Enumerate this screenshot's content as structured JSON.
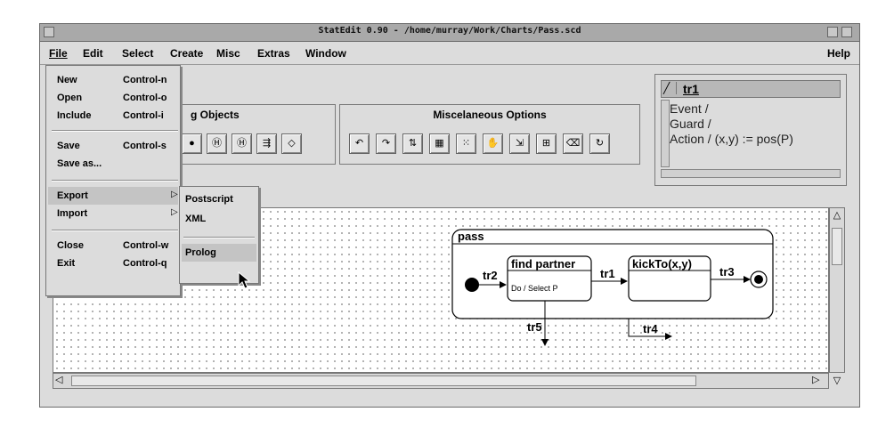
{
  "window": {
    "title": "StatEdit 0.90 - /home/murray/Work/Charts/Pass.scd"
  },
  "menubar": {
    "items": [
      "File",
      "Edit",
      "Select",
      "Create",
      "Misc",
      "Extras",
      "Window"
    ],
    "help": "Help"
  },
  "file_menu": {
    "items": [
      {
        "label": "New",
        "shortcut": "Control-n"
      },
      {
        "label": "Open",
        "shortcut": "Control-o"
      },
      {
        "label": "Include",
        "shortcut": "Control-i"
      },
      {
        "label": "Save",
        "shortcut": "Control-s"
      },
      {
        "label": "Save as...",
        "shortcut": ""
      },
      {
        "label": "Export",
        "shortcut": ""
      },
      {
        "label": "Import",
        "shortcut": ""
      },
      {
        "label": "Close",
        "shortcut": "Control-w"
      },
      {
        "label": "Exit",
        "shortcut": "Control-q"
      }
    ]
  },
  "export_submenu": {
    "items": [
      "Postscript",
      "XML",
      "Prolog"
    ],
    "selected": "Prolog"
  },
  "panels": {
    "drawing_title_partial": "g Objects",
    "misc_title": "Miscelaneous Options",
    "drawing_icons": [
      "filled-circle-icon",
      "history-icon",
      "deep-history-icon",
      "fork-join-icon",
      "condition-icon"
    ],
    "misc_icons": [
      "undo-icon",
      "redo-icon",
      "align-icon",
      "grid-icon",
      "grid-dots-icon",
      "hand-icon",
      "transition-icon",
      "hierarchy-icon",
      "eraser-icon",
      "refresh-icon"
    ],
    "drawing_glyphs": [
      "●",
      "Ⓗ",
      "Ⓗ",
      "⇶",
      "◇"
    ]
  },
  "properties": {
    "name": "tr1",
    "event": "Event /",
    "guard": "Guard /",
    "action": "Action / (x,y) := pos(P)"
  },
  "diagram": {
    "superstate": "pass",
    "state1": "find partner",
    "state1_action": "Do / Select P",
    "state2": "kickTo(x,y)",
    "transitions": [
      "tr2",
      "tr1",
      "tr3",
      "tr5",
      "tr4"
    ]
  }
}
